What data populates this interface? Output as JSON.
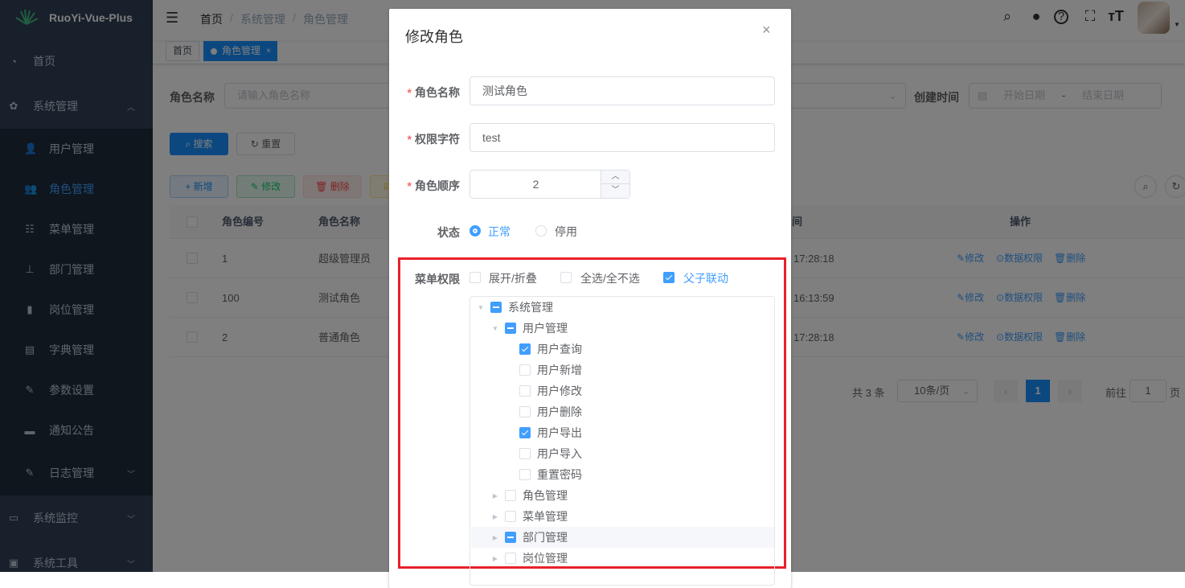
{
  "app": {
    "name": "RuoYi-Vue-Plus"
  },
  "sidebar": {
    "items": [
      {
        "label": "首页",
        "icon": "dashboard-icon"
      },
      {
        "label": "系统管理",
        "icon": "gear-icon",
        "expanded": true
      },
      {
        "label": "用户管理",
        "icon": "user-icon",
        "sub": true
      },
      {
        "label": "角色管理",
        "icon": "peoples-icon",
        "sub": true,
        "active": true
      },
      {
        "label": "菜单管理",
        "icon": "tree-table-icon",
        "sub": true
      },
      {
        "label": "部门管理",
        "icon": "tree-icon",
        "sub": true
      },
      {
        "label": "岗位管理",
        "icon": "post-icon",
        "sub": true
      },
      {
        "label": "字典管理",
        "icon": "dict-icon",
        "sub": true
      },
      {
        "label": "参数设置",
        "icon": "edit-icon",
        "sub": true
      },
      {
        "label": "通知公告",
        "icon": "message-icon",
        "sub": true
      },
      {
        "label": "日志管理",
        "icon": "log-icon",
        "sub": true
      },
      {
        "label": "系统监控",
        "icon": "monitor-icon"
      },
      {
        "label": "系统工具",
        "icon": "tool-icon"
      }
    ]
  },
  "header": {
    "breadcrumb": [
      "首页",
      "系统管理",
      "角色管理"
    ],
    "tags": [
      "首页",
      "角色管理"
    ]
  },
  "search": {
    "role_name_label": "角色名称",
    "role_name_placeholder": "请输入角色名称",
    "create_time_label": "创建时间",
    "start_placeholder": "开始日期",
    "end_placeholder": "结束日期",
    "range_sep": "-",
    "search_btn": "搜索",
    "reset_btn": "重置"
  },
  "toolbar": {
    "add": "新增",
    "edit": "修改",
    "delete": "删除"
  },
  "table": {
    "headers": [
      "角色编号",
      "角色名称",
      "间",
      "操作"
    ],
    "rows": [
      {
        "id": "1",
        "name": "超级管理员",
        "time": "17:28:18"
      },
      {
        "id": "100",
        "name": "测试角色",
        "time": "16:13:59"
      },
      {
        "id": "2",
        "name": "普通角色",
        "time": "17:28:18"
      }
    ],
    "actions": [
      "修改",
      "数据权限",
      "删除"
    ]
  },
  "pagination": {
    "total": "共 3 条",
    "page_size": "10条/页",
    "current": "1",
    "goto_label": "前往",
    "goto_value": "1",
    "page_suffix": "页"
  },
  "modal": {
    "title": "修改角色",
    "fields": {
      "role_name_label": "角色名称",
      "role_name_value": "测试角色",
      "perm_label": "权限字符",
      "perm_value": "test",
      "order_label": "角色顺序",
      "order_value": "2",
      "status_label": "状态",
      "status_options": [
        "正常",
        "停用"
      ],
      "status_selected": "正常",
      "menu_label": "菜单权限"
    },
    "menu_opts": [
      {
        "label": "展开/折叠",
        "checked": false
      },
      {
        "label": "全选/全不选",
        "checked": false
      },
      {
        "label": "父子联动",
        "checked": true
      }
    ],
    "tree": [
      {
        "label": "系统管理",
        "level": 0,
        "state": "ind",
        "arrow": "down"
      },
      {
        "label": "用户管理",
        "level": 1,
        "state": "ind",
        "arrow": "down"
      },
      {
        "label": "用户查询",
        "level": 2,
        "state": "on"
      },
      {
        "label": "用户新增",
        "level": 2,
        "state": "off"
      },
      {
        "label": "用户修改",
        "level": 2,
        "state": "off"
      },
      {
        "label": "用户删除",
        "level": 2,
        "state": "off"
      },
      {
        "label": "用户导出",
        "level": 2,
        "state": "on"
      },
      {
        "label": "用户导入",
        "level": 2,
        "state": "off"
      },
      {
        "label": "重置密码",
        "level": 2,
        "state": "off"
      },
      {
        "label": "角色管理",
        "level": 1,
        "state": "off",
        "arrow": "right"
      },
      {
        "label": "菜单管理",
        "level": 1,
        "state": "off",
        "arrow": "right"
      },
      {
        "label": "部门管理",
        "level": 1,
        "state": "ind",
        "arrow": "right",
        "hover": true
      },
      {
        "label": "岗位管理",
        "level": 1,
        "state": "off",
        "arrow": "right"
      }
    ]
  },
  "colors": {
    "primary": "#409eff",
    "sidebar": "#304156",
    "highlight": "#e8202a"
  }
}
